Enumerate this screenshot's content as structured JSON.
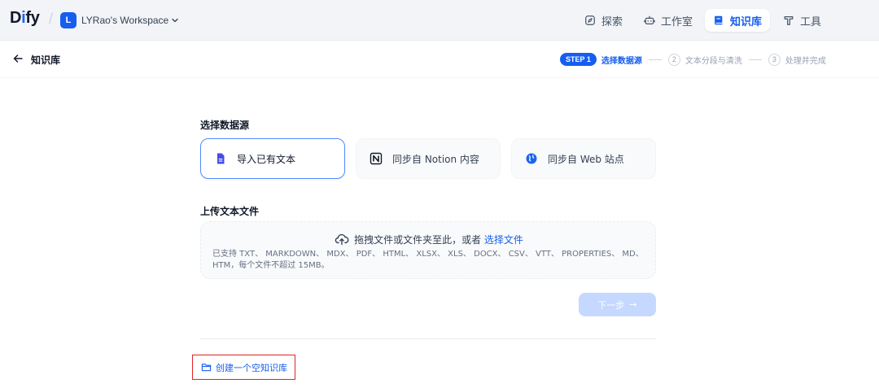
{
  "header": {
    "logo_text_a": "D",
    "logo_text_b": "i",
    "logo_text_c": "fy",
    "workspace": {
      "initial": "L",
      "name": "LYRao's Workspace"
    },
    "nav": [
      {
        "label": "探索",
        "icon": "compass-icon"
      },
      {
        "label": "工作室",
        "icon": "robot-icon"
      },
      {
        "label": "知识库",
        "icon": "book-icon",
        "active": true
      },
      {
        "label": "工具",
        "icon": "hammer-icon"
      }
    ]
  },
  "subheader": {
    "title": "知识库",
    "steps": [
      {
        "badge": "STEP 1",
        "label": "选择数据源",
        "active": true
      },
      {
        "num": "2",
        "label": "文本分段与清洗"
      },
      {
        "num": "3",
        "label": "处理并完成"
      }
    ]
  },
  "source": {
    "title": "选择数据源",
    "options": [
      {
        "label": "导入已有文本",
        "icon": "document-icon",
        "selected": true
      },
      {
        "label": "同步自 Notion 内容",
        "icon": "notion-icon"
      },
      {
        "label": "同步自 Web 站点",
        "icon": "globe-icon"
      }
    ]
  },
  "upload": {
    "title": "上传文本文件",
    "drop_text": "拖拽文件或文件夹至此，或者",
    "browse_link": "选择文件",
    "help": "已支持 TXT、 MARKDOWN、 MDX、 PDF、 HTML、 XLSX、 XLS、 DOCX、 CSV、 VTT、 PROPERTIES、 MD、 HTM，每个文件不超过 15MB。"
  },
  "next_button": {
    "label": "下一步",
    "arrow": "→"
  },
  "empty_kb_link": "创建一个空知识库",
  "colors": {
    "accent": "#155eef",
    "highlight_border": "#e02424"
  }
}
